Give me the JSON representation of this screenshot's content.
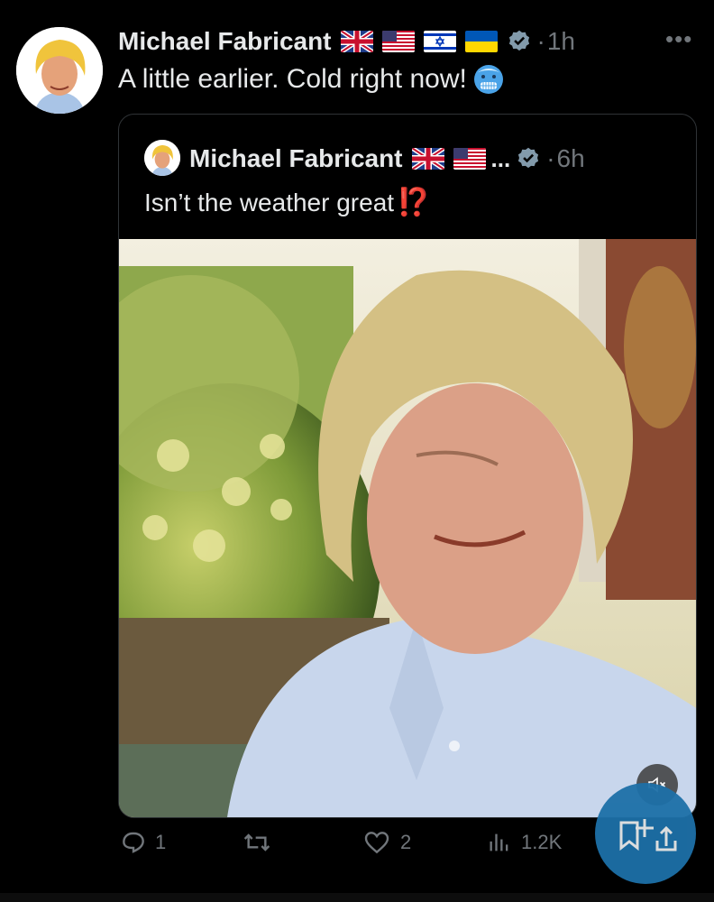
{
  "post": {
    "author": "Michael Fabricant",
    "time": "1h",
    "separator": "·",
    "more": "•••",
    "text": "A little earlier. Cold right now!",
    "emoji": "cold-face"
  },
  "quoted": {
    "author": "Michael Fabricant",
    "ellipsis": "...",
    "time": "6h",
    "separator": "·",
    "text": "Isn’t the weather great",
    "excl": "⁉️"
  },
  "flags": [
    "uk",
    "us",
    "israel",
    "ukraine"
  ],
  "quoted_flags": [
    "uk",
    "us"
  ],
  "actions": {
    "replies": "1",
    "reposts": "",
    "likes": "2",
    "views": "1.2K"
  },
  "colors": {
    "accent": "#1d9bf0",
    "muted": "#71767b",
    "fab": "#1d70a8",
    "background": "#000000",
    "exclamation": "#e0342a"
  }
}
